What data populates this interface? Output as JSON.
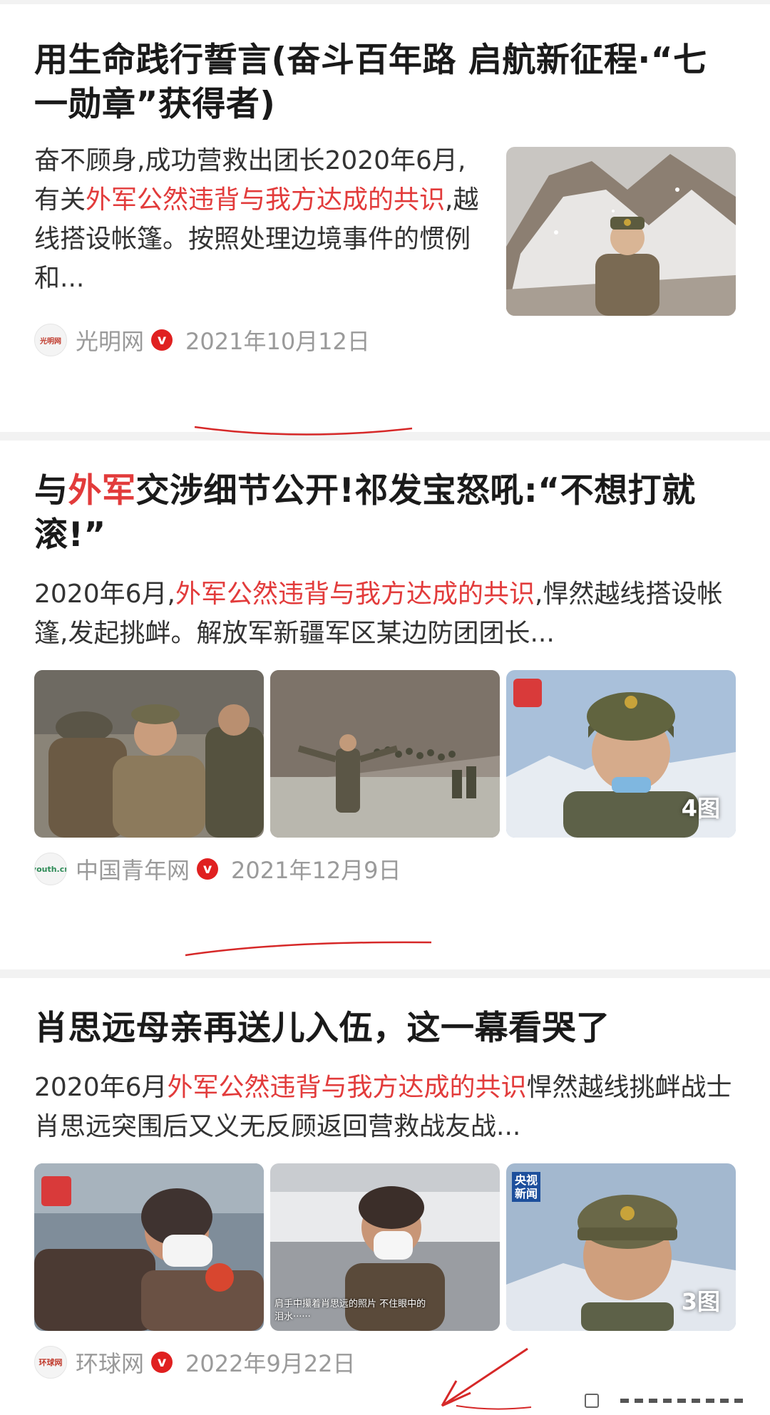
{
  "articles": [
    {
      "title": "用生命践行誓言(奋斗百年路 启航新征程·“七一勋章”获得者)",
      "summary_pre": "奋不顾身,成功营救出团长2020年6月,有关",
      "summary_hl": "外军公然违背与我方达成的共识",
      "summary_post": ",越线搭设帐篷。按照处理边境事件的惯例和...",
      "source_logo": "光明网",
      "source": "光明网",
      "verified": "v",
      "date": "2021年10月12日"
    },
    {
      "title_pre": "与",
      "title_hl": "外军",
      "title_post": "交涉细节公开!祁发宝怒吼:“不想打就滚!”",
      "summary_pre": "2020年6月,",
      "summary_hl": "外军公然违背与我方达成的共识",
      "summary_post": ",悍然越线搭设帐篷,发起挑衅。解放军新疆军区某边防团团长...",
      "image_count": "4图",
      "source_logo": "youth.cn",
      "source": "中国青年网",
      "verified": "v",
      "date": "2021年12月9日"
    },
    {
      "title": "肖思远母亲再送儿入伍，这一幕看哭了",
      "summary_pre": "2020年6月",
      "summary_hl": "外军公然违背与我方达成的共识",
      "summary_post": "悍然越线挑衅战士肖思远突围后又义无反顾返回营救战友战...",
      "image_caption": "肩手中攥着肖思远的照片 不住眼中的泪水······",
      "image_badge": "央视新闻",
      "image_count": "3图",
      "source_logo": "环球网",
      "source": "环球网",
      "verified": "v",
      "date": "2022年9月22日"
    }
  ],
  "colors": {
    "highlight": "#e23b3b",
    "verified": "#e02020",
    "meta": "#9a9a9a",
    "separator": "#f2f2f2"
  }
}
